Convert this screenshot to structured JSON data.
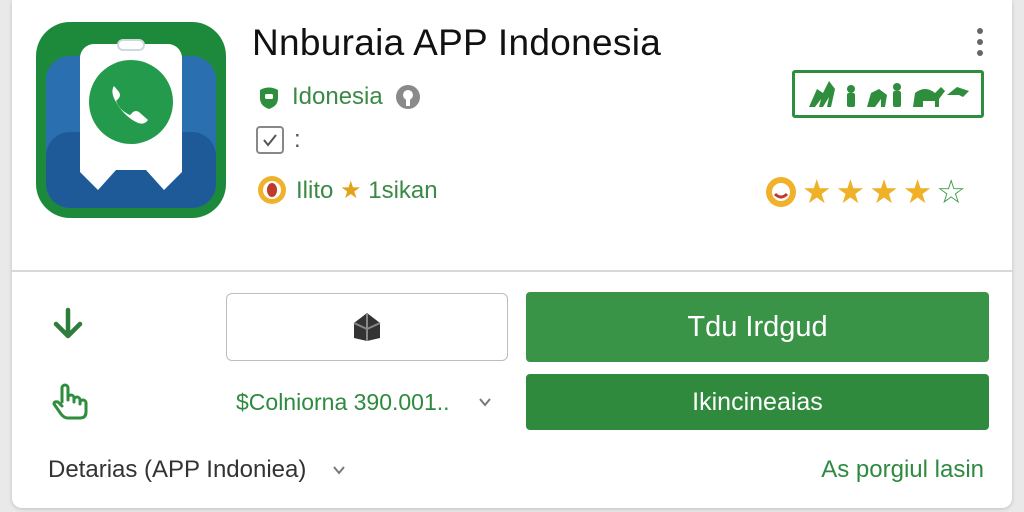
{
  "app": {
    "title": "Nnburaia APP Indonesia",
    "developer": "Idonesia",
    "meta_value": ":",
    "rating_prefix": "Ilito",
    "rating_star": "★",
    "rating_suffix": " 1sikan",
    "stars_rating": 4,
    "stars_total": 5
  },
  "actions": {
    "install_label": "Tdu Irdgud",
    "secondary_label": "Ikincineaias",
    "price_select_value": "$Colniorna 390.001.."
  },
  "footer": {
    "details_label": "Detarias (APP Indoniea)",
    "more_link": "As porgiul lasin"
  },
  "icons": {
    "app_icon": "whatsapp-style-phone-icon",
    "download": "download-arrow-icon",
    "tap": "hand-pointer-icon",
    "share": "share-icon",
    "verified": "verified-icon",
    "developer": "developer-badge-icon",
    "meta": "checkbox-icon",
    "rating_badge": "rating-face-icon",
    "more": "kebab-menu-icon"
  },
  "colors": {
    "brand_green": "#3a9447",
    "dark_green": "#2f8a3e",
    "star_gold": "#efb128",
    "app_icon_blue": "#2a6fb0"
  }
}
